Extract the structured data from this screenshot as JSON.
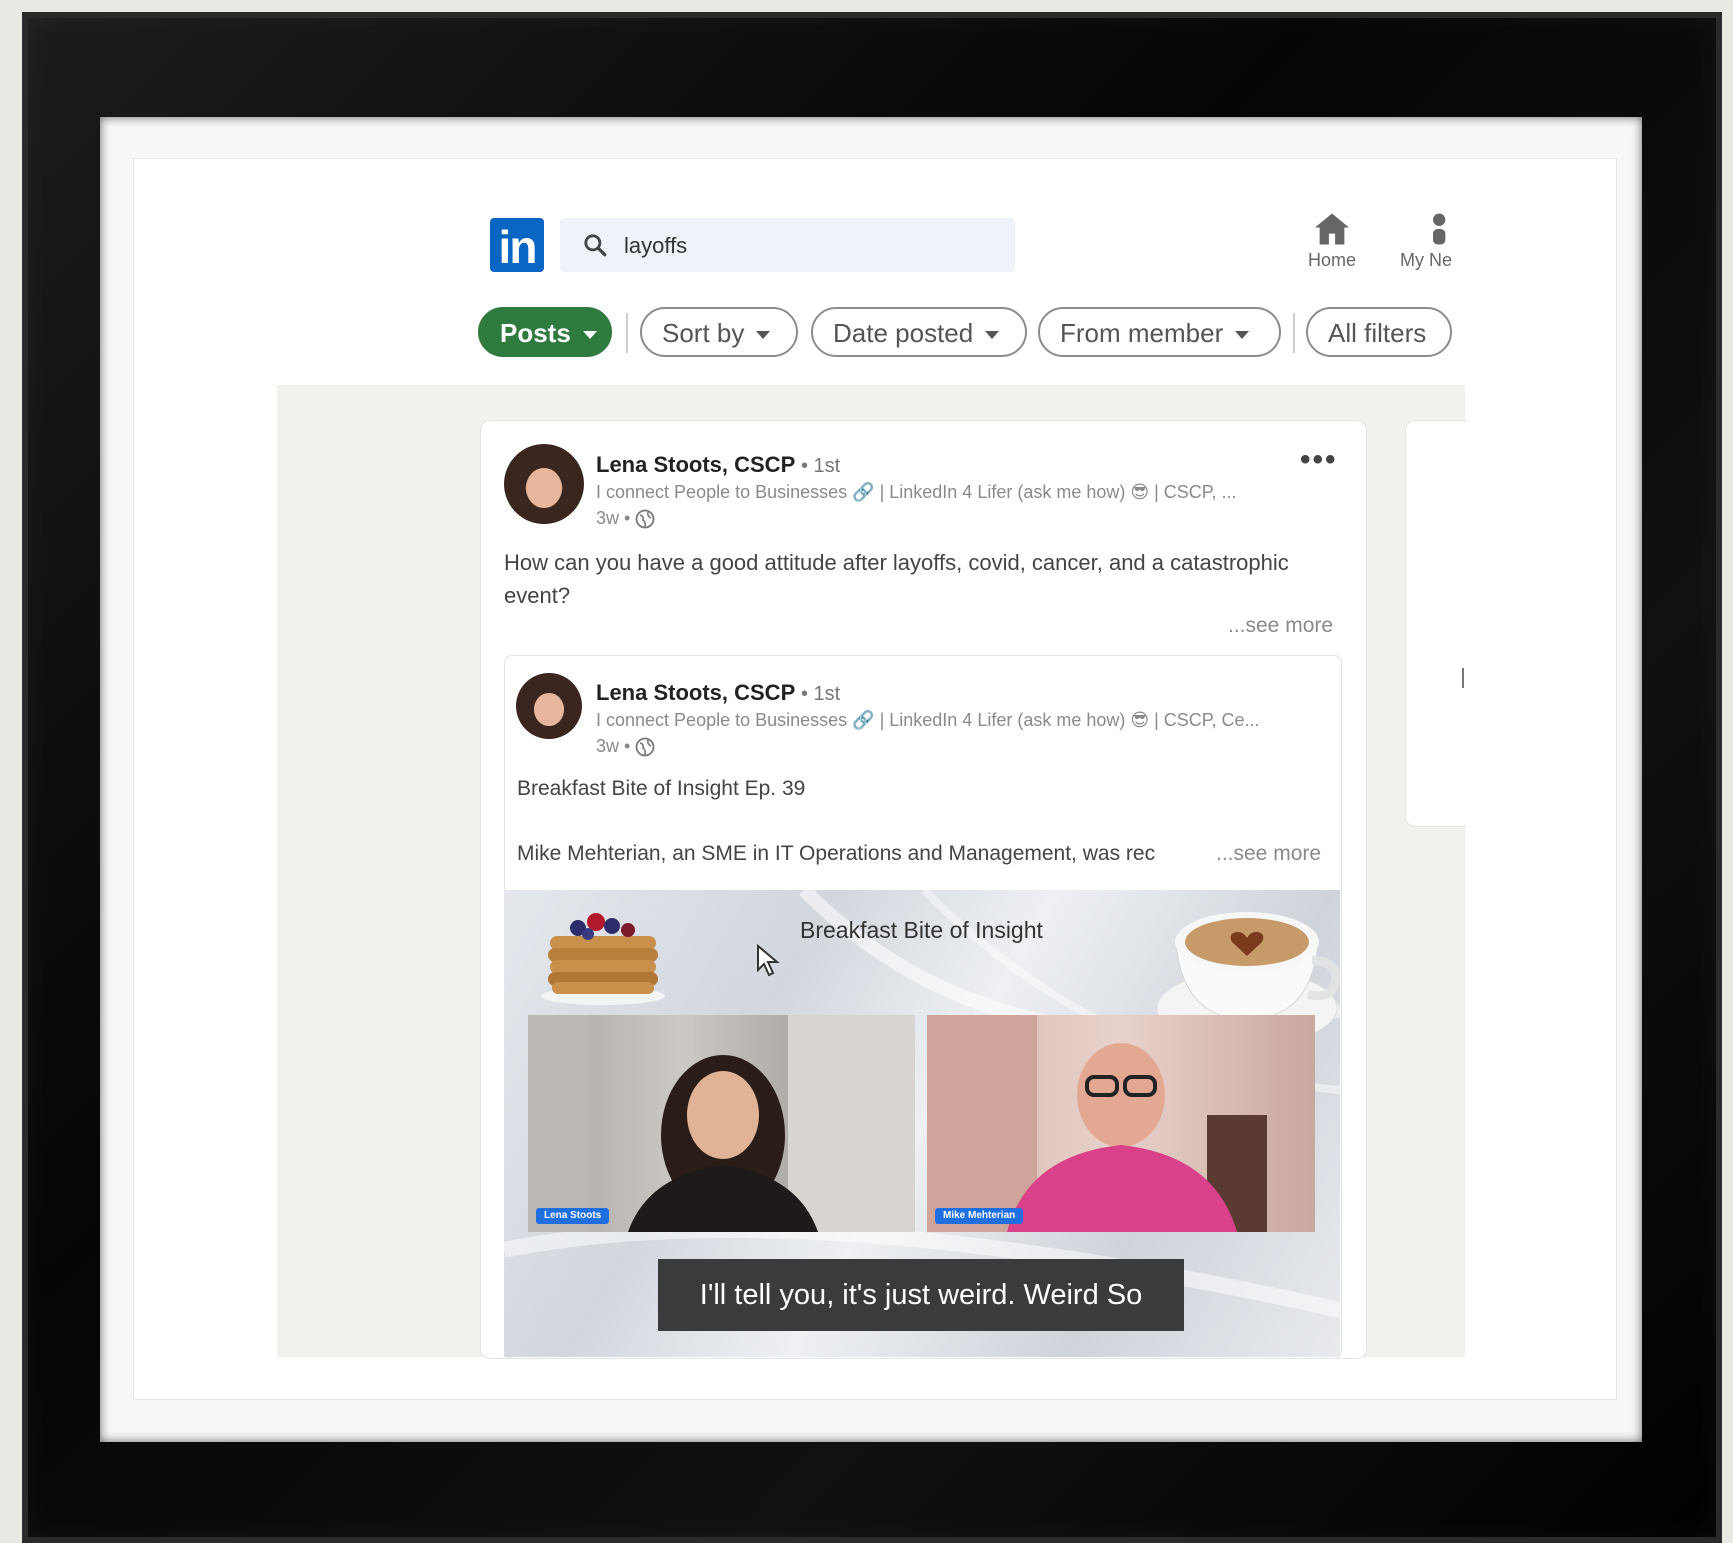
{
  "nav": {
    "logo": "in",
    "search": {
      "value": "layoffs"
    },
    "items": [
      {
        "label": "Home",
        "icon": "home-icon"
      },
      {
        "label": "My Ne",
        "icon": "person-icon"
      }
    ]
  },
  "filters": {
    "posts": "Posts",
    "sort_by": "Sort by",
    "date_posted": "Date posted",
    "from_member": "From member",
    "all_filters": "All filters"
  },
  "post": {
    "author": "Lena Stoots, CSCP",
    "degree": "• 1st",
    "headline": "I connect People to Businesses 🔗 | LinkedIn 4 Lifer (ask me how) 😎 | CSCP, ...",
    "time": "3w •",
    "text": "How can you have a good attitude after layoffs, covid, cancer, and a catastrophic event?",
    "see_more": "...see more",
    "more_menu": "•••"
  },
  "shared_post": {
    "author": "Lena Stoots, CSCP",
    "degree": "• 1st",
    "headline": "I connect People to Businesses 🔗 | LinkedIn 4 Lifer (ask me how) 😎 | CSCP, Ce...",
    "time": "3w •",
    "title": "Breakfast Bite of Insight Ep. 39",
    "text": "Mike Mehterian, an SME in IT Operations and Management, was rec",
    "see_more": "...see more"
  },
  "video": {
    "title": "Breakfast Bite of Insight",
    "caption": "I'll tell you, it's just weird. Weird So",
    "left_tag": "Lena Stoots",
    "right_tag": "Mike Mehterian"
  },
  "colors": {
    "linkedin_blue": "#0a66c2",
    "posts_pill_green": "#2f7a3f",
    "caption_bg": "#3a3b3c"
  }
}
